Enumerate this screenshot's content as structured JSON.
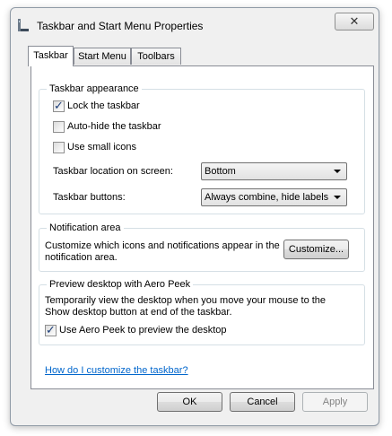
{
  "window": {
    "title": "Taskbar and Start Menu Properties",
    "close_glyph": "✕",
    "icon": "taskbar-icon"
  },
  "tabs": [
    {
      "label": "Taskbar"
    },
    {
      "label": "Start Menu"
    },
    {
      "label": "Toolbars"
    }
  ],
  "taskbar_appearance": {
    "title": "Taskbar appearance",
    "lock": {
      "label": "Lock the taskbar",
      "checked": true
    },
    "autohide": {
      "label": "Auto-hide the taskbar",
      "checked": false
    },
    "small_icons": {
      "label": "Use small icons",
      "checked": false
    },
    "location_label": "Taskbar location on screen:",
    "location_value": "Bottom",
    "buttons_label": "Taskbar buttons:",
    "buttons_value": "Always combine, hide labels"
  },
  "notification_area": {
    "title": "Notification area",
    "desc_line1": "Customize which icons and notifications appear in the",
    "desc_line2": "notification area.",
    "customize_button": "Customize..."
  },
  "aero_peek": {
    "title": "Preview desktop with Aero Peek",
    "desc_line1": "Temporarily view the desktop when you move your mouse to the",
    "desc_line2": "Show desktop button at end of the taskbar.",
    "checkbox": {
      "label": "Use Aero Peek to preview the desktop",
      "checked": true
    }
  },
  "help_link": "How do I customize the taskbar?",
  "footer": {
    "ok": "OK",
    "cancel": "Cancel",
    "apply": "Apply"
  },
  "check_glyph": "✓"
}
